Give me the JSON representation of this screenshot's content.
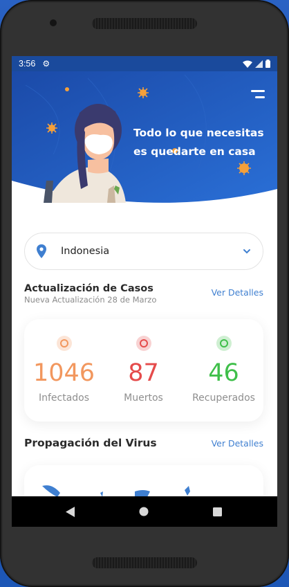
{
  "statusbar": {
    "time": "3:56"
  },
  "hero": {
    "title_line1": "Todo lo que necesitas",
    "title_line2": "es quedarte en casa"
  },
  "country": {
    "selected": "Indonesia"
  },
  "cases": {
    "title": "Actualización de Casos",
    "subtitle": "Nueva Actualización 28 de Marzo",
    "link": "Ver Detalles",
    "stats": [
      {
        "value": "1046",
        "label": "Infectados",
        "color": "#f2975e"
      },
      {
        "value": "87",
        "label": "Muertos",
        "color": "#e54b4b"
      },
      {
        "value": "46",
        "label": "Recuperados",
        "color": "#3fbf4a"
      }
    ]
  },
  "spread": {
    "title": "Propagación del Virus",
    "link": "Ver Detalles"
  },
  "colors": {
    "accent": "#3f7fd0",
    "hero_blue": "#1f5cc0",
    "status_blue": "#1a4a9c"
  }
}
